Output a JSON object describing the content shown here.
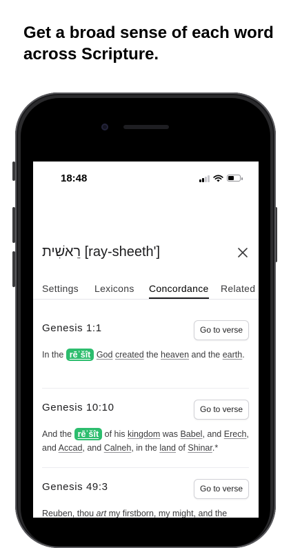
{
  "headline": "Get a broad sense of each word across Scripture.",
  "status_bar": {
    "time": "18:48"
  },
  "word": {
    "hebrew": "רֵאשִׁית",
    "transliteration": "[ray-sheeth']"
  },
  "tabs": [
    {
      "label": "Settings",
      "active": false
    },
    {
      "label": "Lexicons",
      "active": false
    },
    {
      "label": "Concordance",
      "active": true
    },
    {
      "label": "Related",
      "active": false
    }
  ],
  "goto_label": "Go to verse",
  "verses": [
    {
      "ref": "Genesis 1:1",
      "text": {
        "a": "In the",
        "b": "rēʾšît",
        "c": "God",
        "d": "created",
        "e": "the",
        "f": "heaven",
        "g": "and the",
        "h": "earth",
        "i": "."
      }
    },
    {
      "ref": "Genesis 10:10",
      "text": {
        "a": "And the",
        "b": "rēʾšît",
        "c": "of his",
        "d": "kingdom",
        "e": "was",
        "f": "Babel",
        "g": ", and",
        "h": "Erech",
        "i": ", and",
        "j": "Accad",
        "k": ", and",
        "l": "Calneh",
        "m": ", in the",
        "n": "land",
        "o": "of",
        "p": "Shinar",
        "q": ".*"
      }
    },
    {
      "ref": "Genesis 49:3",
      "text": {
        "a": "Reuben, thou",
        "b": "art",
        "c": "my firstborn, my might, and the"
      }
    }
  ],
  "colors": {
    "highlight": "#2dbd6e",
    "text": "#3a3a3c"
  },
  "icons": [
    "close-icon",
    "cellular-signal-icon",
    "wifi-icon",
    "battery-icon",
    "front-camera-icon"
  ]
}
